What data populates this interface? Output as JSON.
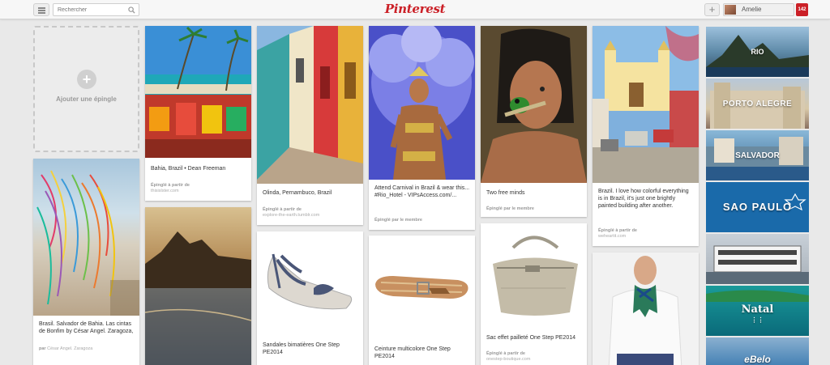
{
  "header": {
    "menu_icon": "hamburger-icon",
    "search_placeholder": "Rechercher",
    "search_icon": "search-icon",
    "logo": "Pinterest",
    "add_icon": "plus-icon",
    "user_name": "Amelie",
    "notifications": "142"
  },
  "add_pin": {
    "label": "Ajouter une épingle"
  },
  "pins": [
    {
      "desc": "Brasil. Salvador de Bahia. Las cintas de Bonfim by César Angel. Zaragoza,",
      "source_prefix": "par",
      "source": "César Angel. Zaragoza"
    },
    {
      "desc": "Bahia, Brazil • Dean Freeman",
      "source_prefix": "Épinglé à partir de",
      "source": "thisislster.com"
    },
    {
      "desc": "Olinda, Pernambuco, Brazil",
      "source_prefix": "Épinglé à partir de",
      "source": "explore-the-earth.tumblr.com"
    },
    {
      "desc": "Sandales bimatières One Step PE2014"
    },
    {
      "desc": "Attend Carnival in Brazil & wear this... #Rio_Hotel - VIPsAccess.com/...",
      "source_prefix": "Épinglé par le membre"
    },
    {
      "desc": "Ceinture multicolore One Step PE2014"
    },
    {
      "desc": "Two free minds",
      "source_prefix": "Épinglé par le membre"
    },
    {
      "desc": "Sac effet pailleté One Step PE2014",
      "source_prefix": "Épinglé à partir de",
      "source": "onestep-boutique.com"
    },
    {
      "desc": "Brazil. I love how colorful everything is in Brazil, it's just one brightly painted building after another.",
      "source_prefix": "Épinglé à partir de",
      "source": "weheartit.com"
    }
  ],
  "boards": [
    "RIO",
    "PORTO ALEGRE",
    "SALVADOR",
    "SAO PAULO",
    "",
    "Natal",
    "eBelo"
  ],
  "colors": {
    "brand": "#cb2027",
    "background": "#e9e9e9"
  }
}
